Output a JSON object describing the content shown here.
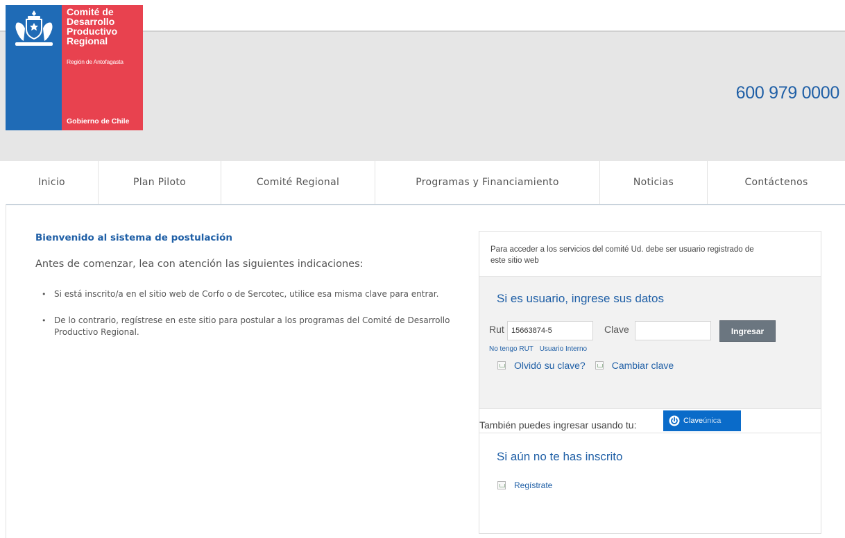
{
  "logo": {
    "title_lines": [
      "Comité de",
      "Desarrollo",
      "Productivo",
      "Regional"
    ],
    "region": "Región de Antofagasta",
    "government": "Gobierno de Chile",
    "colors": {
      "blue": "#1f6bb6",
      "red": "#e8424f"
    }
  },
  "header": {
    "phone": "600 979 0000"
  },
  "nav": {
    "items": [
      {
        "label": "Inicio"
      },
      {
        "label": "Plan Piloto"
      },
      {
        "label": "Comité Regional"
      },
      {
        "label": "Programas y Financiamiento"
      },
      {
        "label": "Noticias"
      },
      {
        "label": "Contáctenos"
      }
    ]
  },
  "welcome": {
    "title": "Bienvenido al sistema de postulación",
    "subtitle": "Antes de comenzar, lea con atención las siguientes indicaciones:",
    "bullets": [
      "Si está inscrito/a en el sitio web de Corfo o de Sercotec, utilice esa misma clave para entrar.",
      "De lo contrario, regístrese en este sitio para postular a los programas del Comité de Desarrollo Productivo Regional."
    ]
  },
  "login": {
    "note": "Para acceder a los servicios del comité Ud. debe ser usuario registrado de este sitio web",
    "title": "Si es usuario, ingrese sus datos",
    "rut_label": "Rut",
    "rut_value": "15663874-5",
    "clave_label": "Clave",
    "clave_value": "",
    "submit_label": "Ingresar",
    "no_rut_link": "No tengo RUT",
    "internal_user_link": "Usuario Interno",
    "forgot_link": "Olvidó su clave?",
    "change_link": "Cambiar clave",
    "also_text": "También puedes ingresar usando tu:",
    "clave_unica_label_a": "Clave",
    "clave_unica_label_b": "única",
    "accent_color": "#1f5fa6"
  },
  "register": {
    "title": "Si aún no te has inscrito",
    "link": "Regístrate"
  }
}
